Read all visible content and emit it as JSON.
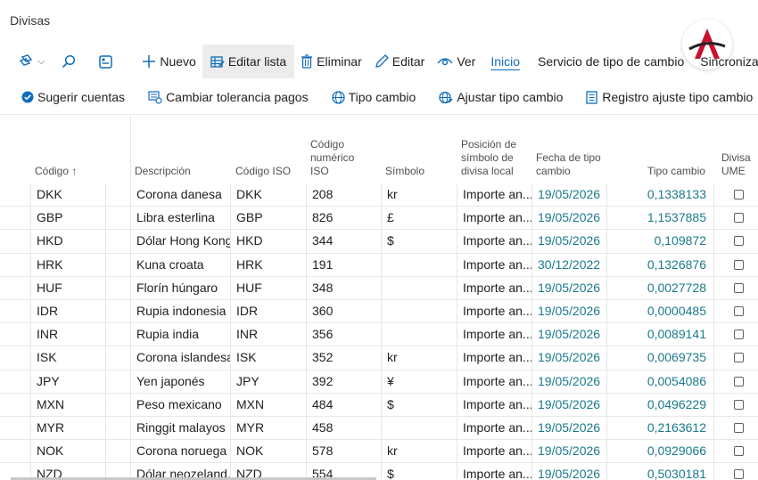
{
  "page": {
    "title": "Divisas"
  },
  "actions": {
    "nuevo": "Nuevo",
    "editar_lista": "Editar lista",
    "eliminar": "Eliminar",
    "editar": "Editar",
    "ver": "Ver",
    "inicio": "Inicio",
    "servicio": "Servicio de tipo de cambio",
    "sincronizar": "Sincronizar"
  },
  "actions2": {
    "sugerir": "Sugerir cuentas",
    "tolerancia": "Cambiar tolerancia pagos",
    "tipo": "Tipo cambio",
    "ajustar": "Ajustar tipo cambio",
    "registro": "Registro ajuste tipo cambio"
  },
  "columns": {
    "codigo": "Código ↑",
    "descripcion": "Descripción",
    "codigo_iso": "Código ISO",
    "codigo_num_1": "Código",
    "codigo_num_2": "numérico",
    "codigo_num_3": "ISO",
    "simbolo": "Símbolo",
    "posicion_1": "Posición de",
    "posicion_2": "símbolo de",
    "posicion_3": "divisa local",
    "fecha_1": "Fecha de tipo",
    "fecha_2": "cambio",
    "tipo_cambio": "Tipo cambio",
    "ume_1": "Divisa",
    "ume_2": "UME"
  },
  "rows": [
    {
      "code": "DKK",
      "desc": "Corona danesa",
      "iso": "DKK",
      "num": "208",
      "sym": "kr",
      "pos": "Importe an...",
      "date": "19/05/2026",
      "rate": "0,1338133"
    },
    {
      "code": "GBP",
      "desc": "Libra esterlina",
      "iso": "GBP",
      "num": "826",
      "sym": "£",
      "pos": "Importe an...",
      "date": "19/05/2026",
      "rate": "1,1537885"
    },
    {
      "code": "HKD",
      "desc": "Dólar Hong Kong",
      "iso": "HKD",
      "num": "344",
      "sym": "$",
      "pos": "Importe an...",
      "date": "19/05/2026",
      "rate": "0,109872"
    },
    {
      "code": "HRK",
      "desc": "Kuna croata",
      "iso": "HRK",
      "num": "191",
      "sym": "",
      "pos": "Importe an...",
      "date": "30/12/2022",
      "rate": "0,1326876"
    },
    {
      "code": "HUF",
      "desc": "Florín húngaro",
      "iso": "HUF",
      "num": "348",
      "sym": "",
      "pos": "Importe an...",
      "date": "19/05/2026",
      "rate": "0,0027728"
    },
    {
      "code": "IDR",
      "desc": "Rupia indonesia",
      "iso": "IDR",
      "num": "360",
      "sym": "",
      "pos": "Importe an...",
      "date": "19/05/2026",
      "rate": "0,0000485"
    },
    {
      "code": "INR",
      "desc": "Rupia india",
      "iso": "INR",
      "num": "356",
      "sym": "",
      "pos": "Importe an...",
      "date": "19/05/2026",
      "rate": "0,0089141"
    },
    {
      "code": "ISK",
      "desc": "Corona islandesa",
      "iso": "ISK",
      "num": "352",
      "sym": "kr",
      "pos": "Importe an...",
      "date": "19/05/2026",
      "rate": "0,0069735"
    },
    {
      "code": "JPY",
      "desc": "Yen japonés",
      "iso": "JPY",
      "num": "392",
      "sym": "¥",
      "pos": "Importe an...",
      "date": "19/05/2026",
      "rate": "0,0054086"
    },
    {
      "code": "MXN",
      "desc": "Peso mexicano",
      "iso": "MXN",
      "num": "484",
      "sym": "$",
      "pos": "Importe an...",
      "date": "19/05/2026",
      "rate": "0,0496229"
    },
    {
      "code": "MYR",
      "desc": "Ringgit malayos",
      "iso": "MYR",
      "num": "458",
      "sym": "",
      "pos": "Importe an...",
      "date": "19/05/2026",
      "rate": "0,2163612"
    },
    {
      "code": "NOK",
      "desc": "Corona noruega",
      "iso": "NOK",
      "num": "578",
      "sym": "kr",
      "pos": "Importe an...",
      "date": "19/05/2026",
      "rate": "0,0929066"
    },
    {
      "code": "NZD",
      "desc": "Dólar neozeland...",
      "iso": "NZD",
      "num": "554",
      "sym": "$",
      "pos": "Importe an...",
      "date": "19/05/2026",
      "rate": "0,5030181"
    }
  ],
  "colors": {
    "accent": "#0f6cbd",
    "link_teal": "#1a7a8c",
    "logo_red": "#c8102e"
  }
}
